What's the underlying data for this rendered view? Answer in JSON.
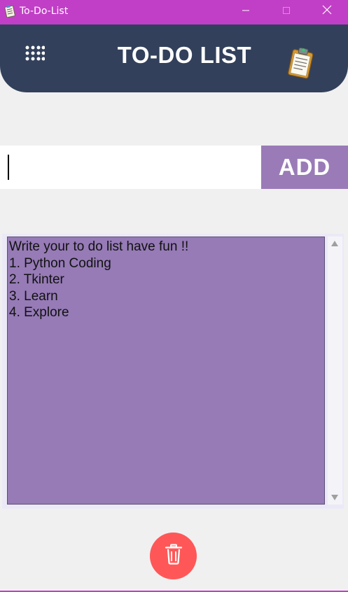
{
  "window": {
    "title": "To-Do-List",
    "titlebar_color": "#c13fc6",
    "app_icon": "notepad-icon",
    "controls": [
      "minimize-icon",
      "maximize-icon",
      "close-icon"
    ]
  },
  "header": {
    "title": "TO-DO LIST",
    "background": "#32405b",
    "menu_icon": "grid-dots-icon",
    "logo_icon": "clipboard-icon"
  },
  "task_entry": {
    "value": "",
    "placeholder": ""
  },
  "add_button": {
    "label": "ADD",
    "background": "#9a7bb7"
  },
  "task_list": {
    "background": "#967bb6",
    "items": [
      "Write your to do list have fun !!",
      "1. Python Coding",
      "2. Tkinter",
      "3. Learn",
      "4. Explore"
    ]
  },
  "delete_button": {
    "icon": "trash-icon",
    "background": "#ff5757"
  }
}
